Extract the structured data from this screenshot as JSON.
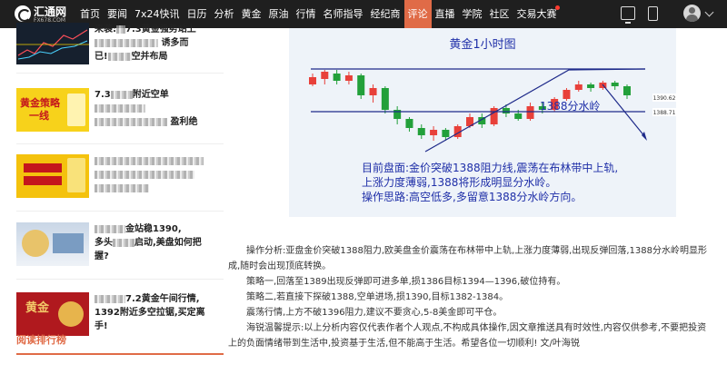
{
  "site": {
    "logo_name": "汇通网",
    "logo_domain": "FX678.COM"
  },
  "nav": {
    "items": [
      "首页",
      "要闻",
      "7x24快讯",
      "日历",
      "分析",
      "黄金",
      "原油",
      "行情",
      "名师指导",
      "经纪商",
      "评论",
      "直播",
      "学院",
      "社区",
      "交易大赛"
    ],
    "active": "评论"
  },
  "sidebar": {
    "articles": [
      {
        "title_1": "来袭:",
        "title_2": "7.3黄金强势站上",
        "title_3": "诱多而",
        "title_4": "已!",
        "title_5": "空并布局",
        "thumb": "chart"
      },
      {
        "title_1": "7.3",
        "title_2": "附近空单",
        "title_3": "盈利绝",
        "thumb_text_1": "黄金策略",
        "thumb_text_2": "一线",
        "thumb": "yellow"
      },
      {
        "title_1": "",
        "thumb_text_1": "",
        "thumb": "yellow2"
      },
      {
        "title_1": "金站稳1390,",
        "title_2": "多头",
        "title_3": "启动,美盘如何把",
        "title_4": "握?",
        "thumb": "gold"
      },
      {
        "title_1": "7.2黄金午间行情,",
        "title_2": "1392附近多空拉锯,买定离",
        "title_3": "手!",
        "thumb_text_1": "黄金",
        "thumb": "red"
      }
    ],
    "ranking_title": "阅读排行榜"
  },
  "chart": {
    "title": "黄金1小时图",
    "label_resistance": "1388分水岭",
    "price_tag_1": "1390.62",
    "price_tag_2": "1388.71",
    "note_line_1": "目前盘面:金价突破1388阻力线,震荡在布林带中上轨,",
    "note_line_2": "上涨力度薄弱,1388将形成明显分水岭。",
    "note_line_3": "操作思路:高空低多,多留意1388分水岭方向。"
  },
  "chart_data": {
    "type": "candlestick",
    "title": "黄金1小时图",
    "resistance_level": 1388,
    "candles": [
      {
        "o": 1392.0,
        "c": 1394.0,
        "h": 1395.0,
        "l": 1391.5
      },
      {
        "o": 1393.5,
        "c": 1395.5,
        "h": 1396.0,
        "l": 1392.0
      },
      {
        "o": 1395.0,
        "c": 1393.0,
        "h": 1396.0,
        "l": 1392.0
      },
      {
        "o": 1393.0,
        "c": 1394.5,
        "h": 1395.5,
        "l": 1392.0
      },
      {
        "o": 1394.5,
        "c": 1389.0,
        "h": 1395.0,
        "l": 1388.0
      },
      {
        "o": 1389.0,
        "c": 1391.0,
        "h": 1392.0,
        "l": 1387.0
      },
      {
        "o": 1391.0,
        "c": 1385.0,
        "h": 1391.5,
        "l": 1384.0
      },
      {
        "o": 1385.0,
        "c": 1382.5,
        "h": 1386.0,
        "l": 1381.0
      },
      {
        "o": 1382.5,
        "c": 1380.0,
        "h": 1383.0,
        "l": 1379.0
      },
      {
        "o": 1380.0,
        "c": 1378.0,
        "h": 1381.0,
        "l": 1377.0
      },
      {
        "o": 1378.0,
        "c": 1379.5,
        "h": 1380.5,
        "l": 1376.5
      },
      {
        "o": 1379.5,
        "c": 1377.5,
        "h": 1380.0,
        "l": 1376.5
      },
      {
        "o": 1377.5,
        "c": 1380.5,
        "h": 1381.0,
        "l": 1377.0
      },
      {
        "o": 1380.5,
        "c": 1383.0,
        "h": 1384.0,
        "l": 1380.0
      },
      {
        "o": 1383.0,
        "c": 1381.0,
        "h": 1384.0,
        "l": 1380.0
      },
      {
        "o": 1381.0,
        "c": 1385.5,
        "h": 1386.0,
        "l": 1380.5
      },
      {
        "o": 1385.5,
        "c": 1384.0,
        "h": 1386.5,
        "l": 1383.0
      },
      {
        "o": 1384.0,
        "c": 1382.5,
        "h": 1385.0,
        "l": 1382.0
      },
      {
        "o": 1382.5,
        "c": 1386.0,
        "h": 1387.0,
        "l": 1382.0
      },
      {
        "o": 1386.0,
        "c": 1385.0,
        "h": 1387.0,
        "l": 1384.0
      },
      {
        "o": 1385.0,
        "c": 1388.0,
        "h": 1388.5,
        "l": 1384.5
      },
      {
        "o": 1388.0,
        "c": 1390.5,
        "h": 1391.0,
        "l": 1387.5
      },
      {
        "o": 1390.5,
        "c": 1392.0,
        "h": 1393.0,
        "l": 1390.0
      },
      {
        "o": 1392.0,
        "c": 1391.0,
        "h": 1392.5,
        "l": 1390.0
      },
      {
        "o": 1391.0,
        "c": 1392.5,
        "h": 1393.0,
        "l": 1390.5
      },
      {
        "o": 1392.5,
        "c": 1391.5,
        "h": 1393.0,
        "l": 1390.5
      },
      {
        "o": 1391.5,
        "c": 1389.0,
        "h": 1392.0,
        "l": 1388.0
      }
    ],
    "ylim": [
      1370,
      1400
    ],
    "colors": {
      "up": "#e8403a",
      "down": "#22a03a",
      "background": "#eef3f9",
      "lines": "#1e2a8a"
    }
  },
  "article": {
    "p1": "操作分析:亚盘金价突破1388阻力,欧美盘金价震荡在布林带中上轨,上涨力度薄弱,出现反弹回落,1388分水岭明显形成,随时会出现顶底转换。",
    "p2": "策略一,回落至1389出现反弹即可进多单,损1386目标1394—1396,破位持有。",
    "p3": "策略二,若直接下探破1388,空单进场,损1390,目标1382-1384。",
    "p4": "震荡行情,上方不破1396阻力,建议不要贪心,5-8美金即可平仓。",
    "p5": "海锐温馨提示:以上分析内容仅代表作者个人观点,不构成具体操作,因文章推送具有时效性,内容仅供参考,不要把投资上的负面情绪带到生活中,投资基于生活,但不能高于生活。希望各位一切顺利! 文/叶海锐"
  }
}
